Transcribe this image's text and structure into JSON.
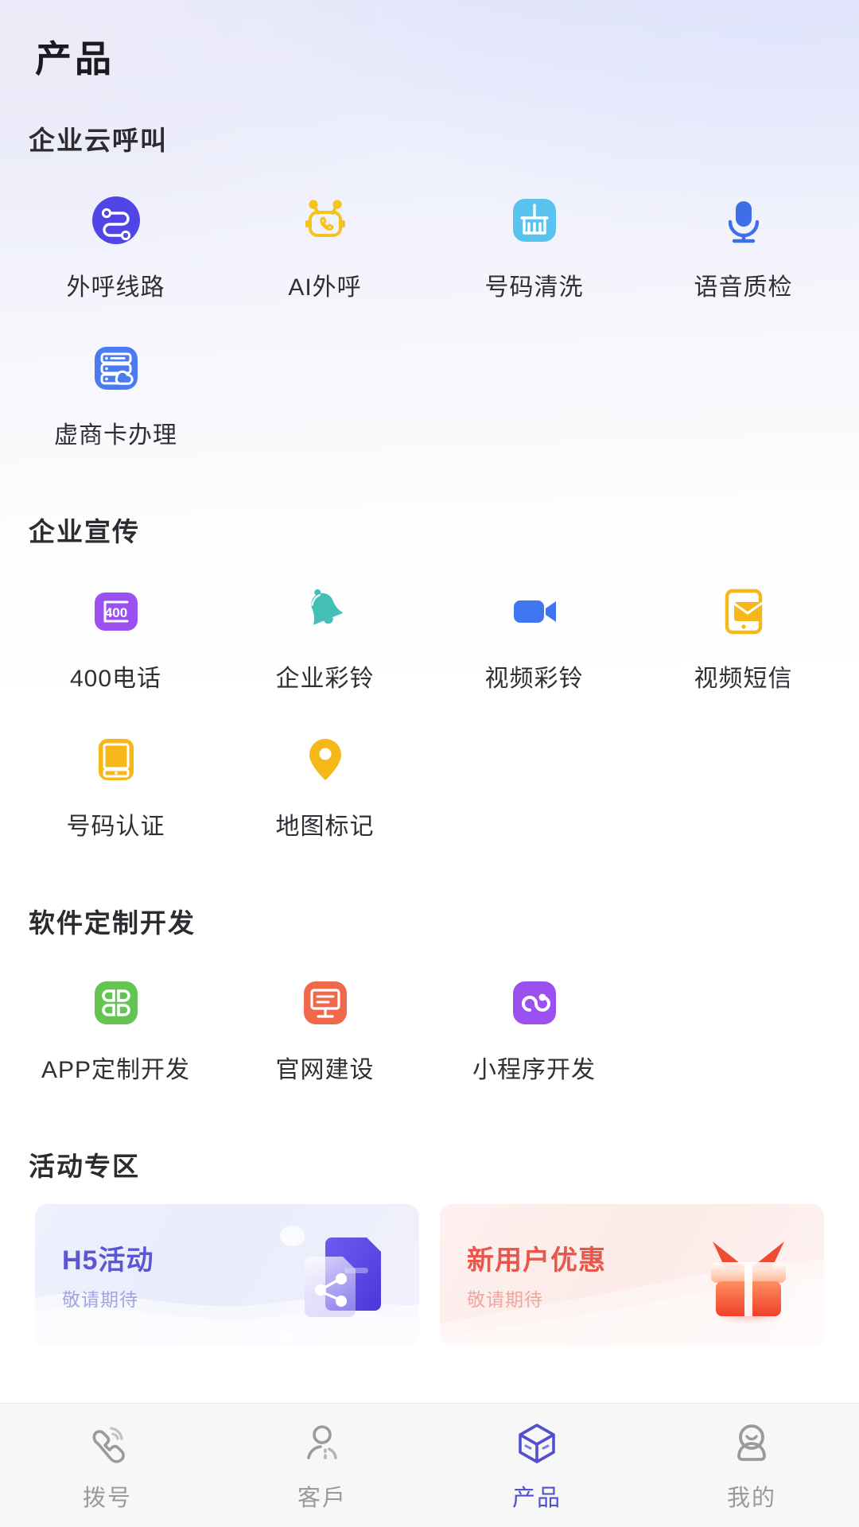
{
  "header": {
    "title": "产品"
  },
  "sections": [
    {
      "title": "企业云呼叫",
      "items": [
        {
          "label": "外呼线路",
          "icon": "outbound-line-icon",
          "color": "#4f46e5"
        },
        {
          "label": "AI外呼",
          "icon": "ai-robot-call-icon",
          "color": "#f5c31c"
        },
        {
          "label": "号码清洗",
          "icon": "number-cleaning-broom-icon",
          "color": "#58c3ef"
        },
        {
          "label": "语音质检",
          "icon": "microphone-icon",
          "color": "#3f6fe8"
        },
        {
          "label": "虚商卡办理",
          "icon": "server-cloud-card-icon",
          "color": "#4b7bf0"
        }
      ]
    },
    {
      "title": "企业宣传",
      "items": [
        {
          "label": "400电话",
          "icon": "400-phone-icon",
          "color": "#9b51f0"
        },
        {
          "label": "企业彩铃",
          "icon": "bell-ringtone-icon",
          "color": "#43bfb8"
        },
        {
          "label": "视频彩铃",
          "icon": "video-camera-icon",
          "color": "#3f76f0"
        },
        {
          "label": "视频短信",
          "icon": "video-sms-icon",
          "color": "#f5b818"
        },
        {
          "label": "号码认证",
          "icon": "phone-certification-icon",
          "color": "#f5b818"
        },
        {
          "label": "地图标记",
          "icon": "map-pin-icon",
          "color": "#f5b818"
        }
      ]
    },
    {
      "title": "软件定制开发",
      "items": [
        {
          "label": "APP定制开发",
          "icon": "app-grid-icon",
          "color": "#63c353"
        },
        {
          "label": "官网建设",
          "icon": "monitor-website-icon",
          "color": "#f0694a"
        },
        {
          "label": "小程序开发",
          "icon": "mini-program-icon",
          "color": "#9b51f0"
        }
      ]
    }
  ],
  "activity": {
    "title": "活动专区",
    "banners": [
      {
        "title": "H5活动",
        "subtitle": "敬请期待",
        "art": "share-document-art",
        "accent": "#5b56d6"
      },
      {
        "title": "新用户优惠",
        "subtitle": "敬请期待",
        "art": "gift-box-art",
        "accent": "#e8574a"
      }
    ]
  },
  "tabbar": {
    "active_color": "#5350cf",
    "inactive_color": "#9a9a9e",
    "tabs": [
      {
        "label": "拨号",
        "icon": "phone-dial-icon",
        "active": false
      },
      {
        "label": "客戶",
        "icon": "customer-person-icon",
        "active": false
      },
      {
        "label": "产品",
        "icon": "cube-product-icon",
        "active": true
      },
      {
        "label": "我的",
        "icon": "profile-person-icon",
        "active": false
      }
    ]
  }
}
